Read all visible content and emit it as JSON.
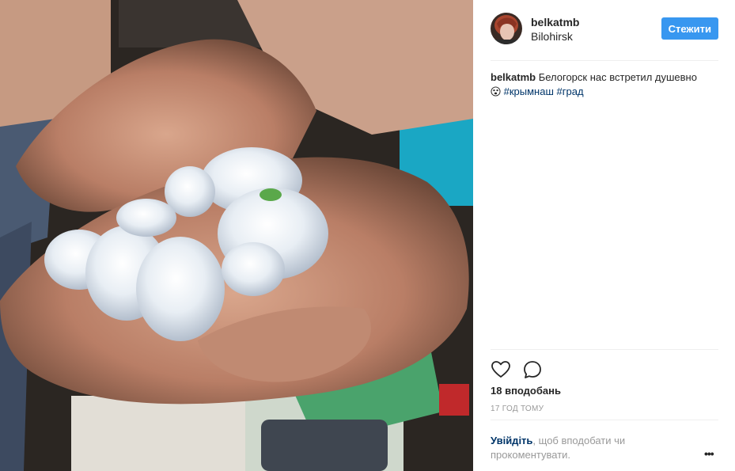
{
  "post": {
    "photo_alt": "",
    "author": {
      "username": "belkatmb",
      "location": "Bilohirsk",
      "avatar_icon": "avatar-photo"
    },
    "follow_label": "Стежити",
    "caption": {
      "username": "belkatmb",
      "text": "Белогорск нас встретил душевно",
      "emoji_icon": "shocked-face-icon",
      "hashtags": [
        "#крымнаш",
        "#град"
      ]
    },
    "actions": {
      "like_icon": "heart-icon",
      "comment_icon": "comment-icon"
    },
    "likes_text": "18 вподобань",
    "timestamp": "17 ГОД ТОМУ",
    "login_prompt": {
      "link": "Увійдіть",
      "text": ", щоб вподобати чи прокоментувати."
    },
    "more_label": "•••"
  },
  "colors": {
    "accent": "#3897f0",
    "link": "#003569",
    "muted": "#999999",
    "text": "#262626",
    "divider": "#efefef"
  }
}
